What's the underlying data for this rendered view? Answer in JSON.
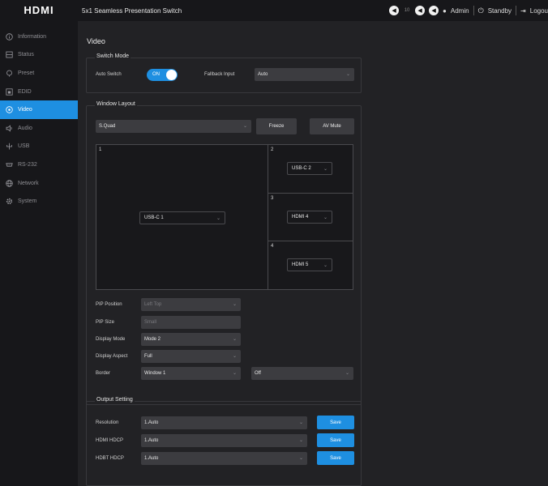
{
  "header": {
    "logo_text": "HDMI",
    "title": "5x1 Seamless Presentation Switch",
    "volume": "10",
    "user": "Admin",
    "standby": "Standby",
    "logout": "Logou"
  },
  "sidebar": {
    "items": [
      {
        "label": "Information",
        "icon": "info-icon"
      },
      {
        "label": "Status",
        "icon": "status-icon"
      },
      {
        "label": "Preset",
        "icon": "preset-icon"
      },
      {
        "label": "EDID",
        "icon": "edid-icon"
      },
      {
        "label": "Video",
        "icon": "video-icon",
        "active": true
      },
      {
        "label": "Audio",
        "icon": "audio-icon"
      },
      {
        "label": "USB",
        "icon": "usb-icon"
      },
      {
        "label": "RS-232",
        "icon": "rs232-icon"
      },
      {
        "label": "Network",
        "icon": "network-icon"
      },
      {
        "label": "System",
        "icon": "system-icon"
      }
    ]
  },
  "page": {
    "title": "Video"
  },
  "switch_mode": {
    "legend": "Switch Mode",
    "auto_switch_label": "Auto Switch",
    "auto_switch_value": "ON",
    "fallback_label": "Fallback Input",
    "fallback_value": "Auto"
  },
  "window_layout": {
    "legend": "Window Layout",
    "layout_value": "S.Quad",
    "freeze_label": "Freeze",
    "av_mute_label": "AV Mute",
    "windows": [
      {
        "num": "1",
        "source": "USB-C 1"
      },
      {
        "num": "2",
        "source": "USB-C 2"
      },
      {
        "num": "3",
        "source": "HDMI 4"
      },
      {
        "num": "4",
        "source": "HDMI 5"
      }
    ],
    "pip_position_label": "PIP Position",
    "pip_position_value": "Left Top",
    "pip_size_label": "PIP Size",
    "pip_size_value": "Small",
    "display_mode_label": "Display Mode",
    "display_mode_value": "Mode 2",
    "display_aspect_label": "Display Aspect",
    "display_aspect_value": "Full",
    "border_label": "Border",
    "border_window_value": "Window 1",
    "border_value": "Off"
  },
  "output_setting": {
    "legend": "Output Setting",
    "rows": [
      {
        "label": "Resolution",
        "value": "1.Auto",
        "save": "Save"
      },
      {
        "label": "HDMI HDCP",
        "value": "1.Auto",
        "save": "Save"
      },
      {
        "label": "HDBT HDCP",
        "value": "1.Auto",
        "save": "Save"
      }
    ]
  },
  "colors": {
    "accent": "#1e8fe1",
    "sidebar_bg": "#17171a",
    "main_bg": "#222225"
  }
}
